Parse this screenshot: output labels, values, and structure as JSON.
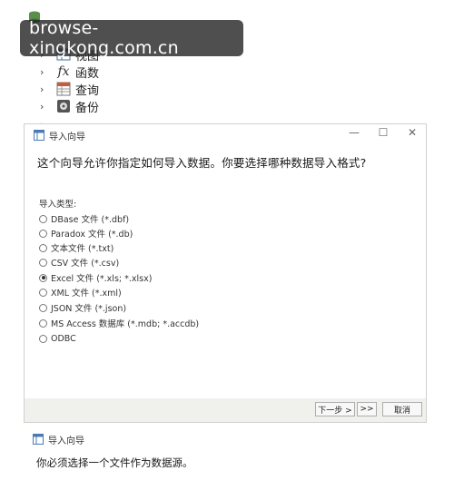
{
  "watermark": "browse-xingkong.com.cn",
  "tree": {
    "items": [
      {
        "label": "视图",
        "icon": "view-icon"
      },
      {
        "label": "函数",
        "icon": "function-icon"
      },
      {
        "label": "查询",
        "icon": "query-icon"
      },
      {
        "label": "备份",
        "icon": "backup-icon"
      }
    ]
  },
  "dialog": {
    "title": "导入向导",
    "heading": "这个向导允许你指定如何导入数据。你要选择哪种数据导入格式?",
    "import_type_label": "导入类型:",
    "options": [
      {
        "label": "DBase 文件 (*.dbf)",
        "selected": false
      },
      {
        "label": "Paradox 文件 (*.db)",
        "selected": false
      },
      {
        "label": "文本文件 (*.txt)",
        "selected": false
      },
      {
        "label": "CSV 文件 (*.csv)",
        "selected": false
      },
      {
        "label": "Excel 文件 (*.xls; *.xlsx)",
        "selected": true
      },
      {
        "label": "XML 文件 (*.xml)",
        "selected": false
      },
      {
        "label": "JSON 文件 (*.json)",
        "selected": false
      },
      {
        "label": "MS Access 数据库 (*.mdb; *.accdb)",
        "selected": false
      },
      {
        "label": "ODBC",
        "selected": false
      }
    ],
    "next_label": "下一步 >",
    "skip_label": ">>",
    "cancel_label": "取消",
    "window_buttons": {
      "minimize": "—",
      "maximize": "☐",
      "close": "✕"
    }
  },
  "dialog2": {
    "title": "导入向导",
    "heading": "你必须选择一个文件作为数据源。"
  }
}
